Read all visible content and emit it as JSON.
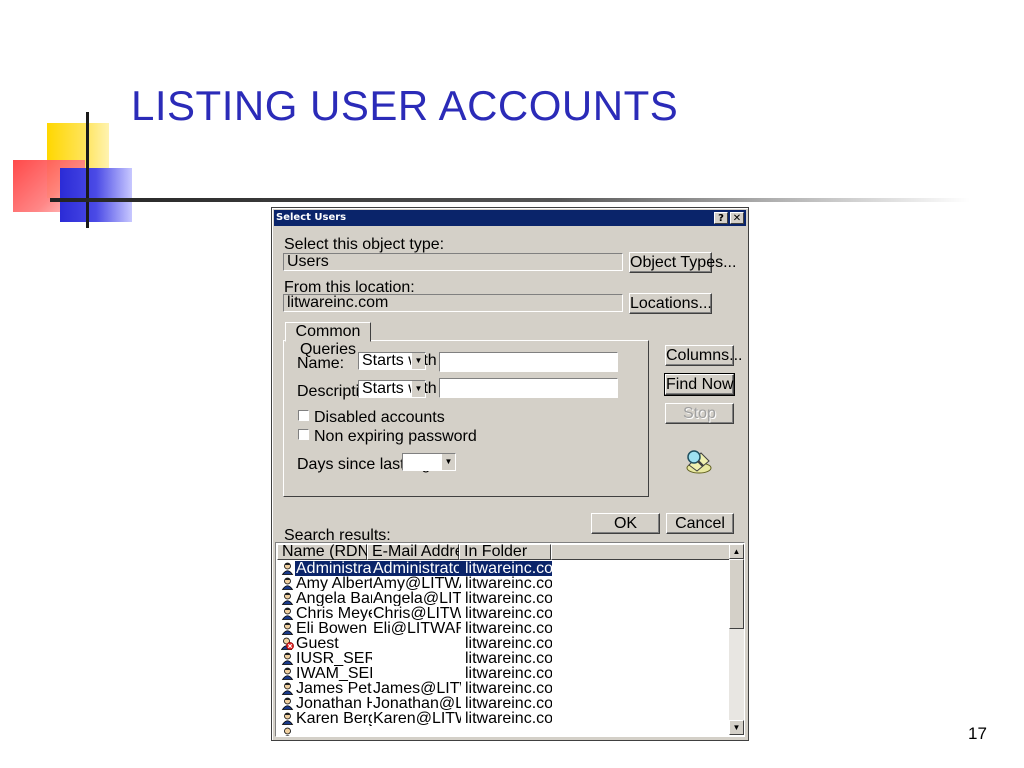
{
  "slide": {
    "title": "LISTING USER ACCOUNTS",
    "number": "17"
  },
  "dialog": {
    "title": "Select Users",
    "help_label": "?",
    "close_label": "✕",
    "object_type_label": "Select this object type:",
    "object_type_value": "Users",
    "object_types_button": "Object Types...",
    "location_label": "From this location:",
    "location_value": "litwareinc.com",
    "locations_button": "Locations...",
    "tab_label": "Common Queries",
    "name_label": "Name:",
    "name_mode": "Starts with",
    "description_label": "Description:",
    "description_mode": "Starts with",
    "disabled_accounts_label": "Disabled accounts",
    "non_expiring_label": "Non expiring password",
    "days_since_label": "Days since last logon:",
    "columns_button": "Columns...",
    "find_now_button": "Find Now",
    "stop_button": "Stop",
    "ok_button": "OK",
    "cancel_button": "Cancel",
    "search_results_label": "Search results:",
    "columns": [
      "Name (RDN)",
      "E-Mail Address",
      "In Folder"
    ],
    "rows": [
      {
        "name": "Administrator",
        "email": "Administrator@L...",
        "folder": "litwareinc.com/...",
        "icon": "user-icon",
        "selected": true
      },
      {
        "name": "Amy Alberts",
        "email": "Amy@LITWAR...",
        "folder": "litwareinc.com/...",
        "icon": "user-icon"
      },
      {
        "name": "Angela Barbar...",
        "email": "Angela@LITWA...",
        "folder": "litwareinc.com/...",
        "icon": "user-icon"
      },
      {
        "name": "Chris Meyer",
        "email": "Chris@LITWAR...",
        "folder": "litwareinc.com/...",
        "icon": "user-icon"
      },
      {
        "name": "Eli Bowen",
        "email": "Eli@LITWAREI...",
        "folder": "litwareinc.com/...",
        "icon": "user-icon"
      },
      {
        "name": "Guest",
        "email": "",
        "folder": "litwareinc.com/...",
        "icon": "disabled-user-icon"
      },
      {
        "name": "IUSR_SERV...",
        "email": "",
        "folder": "litwareinc.com/...",
        "icon": "user-icon"
      },
      {
        "name": "IWAM_SERV...",
        "email": "",
        "folder": "litwareinc.com/...",
        "icon": "user-icon"
      },
      {
        "name": "James Peters",
        "email": "James@LITWA...",
        "folder": "litwareinc.com/...",
        "icon": "user-icon"
      },
      {
        "name": "Jonathan Haas",
        "email": "Jonathan@LIT...",
        "folder": "litwareinc.com/...",
        "icon": "user-icon"
      },
      {
        "name": "Karen Berge",
        "email": "Karen@LITWA...",
        "folder": "litwareinc.com/...",
        "icon": "user-icon"
      }
    ]
  },
  "colors": {
    "title_blue": "#2b2bb8",
    "titlebar": "#0a246a",
    "dialog_face": "#d4d0c8",
    "selection": "#0a246a"
  }
}
